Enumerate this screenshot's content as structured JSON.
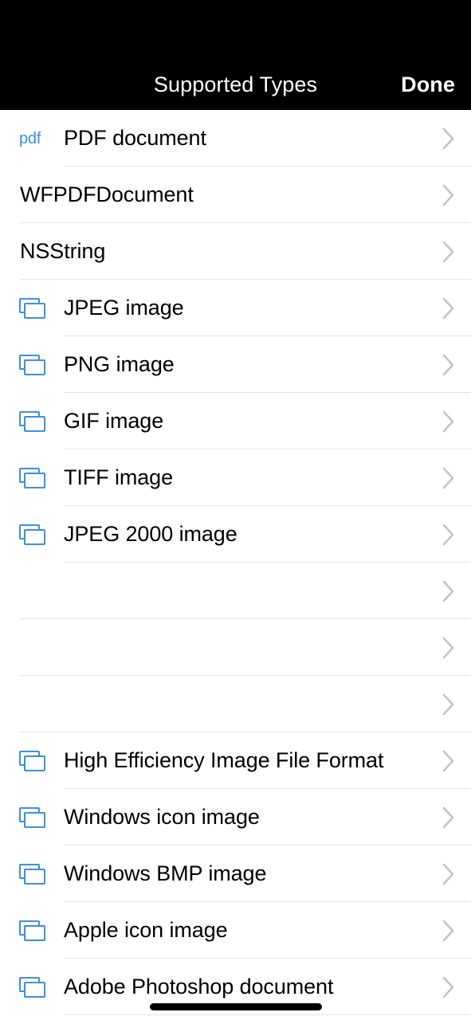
{
  "navbar": {
    "title": "Supported Types",
    "done_label": "Done"
  },
  "colors": {
    "nav_background": "#000000",
    "nav_text": "#ffffff",
    "accent_blue": "#3b8fe8",
    "row_background": "#ffffff",
    "separator": "#e4e4e6",
    "chevron": "#c4c4c6",
    "label_text": "#000000"
  },
  "list": {
    "rows": [
      {
        "label": "PDF document",
        "icon": "pdf-text-icon",
        "chevron": "chevron-right-icon"
      },
      {
        "label": "WFPDFDocument",
        "icon": null,
        "chevron": "chevron-right-icon"
      },
      {
        "label": "NSString",
        "icon": null,
        "chevron": "chevron-right-icon"
      },
      {
        "label": "JPEG image",
        "icon": "stacked-images-icon",
        "chevron": "chevron-right-icon"
      },
      {
        "label": "PNG image",
        "icon": "stacked-images-icon",
        "chevron": "chevron-right-icon"
      },
      {
        "label": "GIF image",
        "icon": "stacked-images-icon",
        "chevron": "chevron-right-icon"
      },
      {
        "label": "TIFF image",
        "icon": "stacked-images-icon",
        "chevron": "chevron-right-icon"
      },
      {
        "label": "JPEG 2000 image",
        "icon": "stacked-images-icon",
        "chevron": "chevron-right-icon"
      },
      {
        "label": "",
        "icon": null,
        "chevron": "chevron-right-icon"
      },
      {
        "label": "",
        "icon": null,
        "chevron": "chevron-right-icon"
      },
      {
        "label": "",
        "icon": null,
        "chevron": "chevron-right-icon"
      },
      {
        "label": "High Efficiency Image File Format",
        "icon": "stacked-images-icon",
        "chevron": "chevron-right-icon"
      },
      {
        "label": "Windows icon image",
        "icon": "stacked-images-icon",
        "chevron": "chevron-right-icon"
      },
      {
        "label": "Windows BMP image",
        "icon": "stacked-images-icon",
        "chevron": "chevron-right-icon"
      },
      {
        "label": "Apple icon image",
        "icon": "stacked-images-icon",
        "chevron": "chevron-right-icon"
      },
      {
        "label": "Adobe Photoshop document",
        "icon": "stacked-images-icon",
        "chevron": "chevron-right-icon"
      }
    ]
  },
  "icons": {
    "pdf_text": "pdf"
  }
}
